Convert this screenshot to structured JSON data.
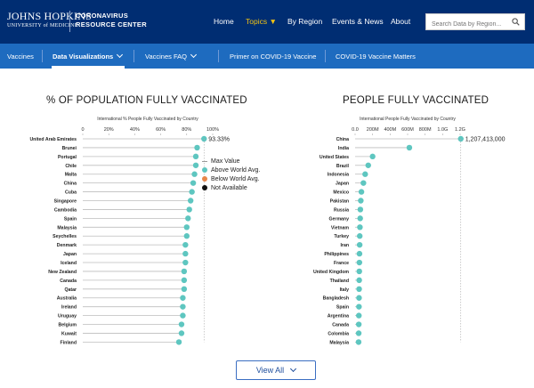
{
  "header": {
    "logo_line1": "JOHNS HOPKINS",
    "logo_line2": "UNIVERSITY of MEDICINE",
    "logo_crc_1": "CORONAVIRUS",
    "logo_crc_2": "RESOURCE CENTER",
    "nav": [
      {
        "label": "Home"
      },
      {
        "label": "Topics ▼"
      },
      {
        "label": "By Region"
      },
      {
        "label": "Events & News"
      },
      {
        "label": "About"
      }
    ],
    "search_placeholder": "Search Data by Region..."
  },
  "subnav": [
    {
      "label": "Vaccines"
    },
    {
      "label": "Data Visualizations"
    },
    {
      "label": "Vaccines FAQ"
    },
    {
      "label": "Primer on COVID-19 Vaccine"
    },
    {
      "label": "COVID-19 Vaccine Matters"
    }
  ],
  "colors": {
    "navy": "#002D72",
    "blue": "#1e6bbf",
    "accent": "#f2c413",
    "dot": "#5ec6c0"
  },
  "legend": {
    "max": "Max Value",
    "above": "Above World Avg.",
    "below": "Below World Avg.",
    "na": "Not Available",
    "above_color": "#5ec6c0",
    "below_color": "#e8864a",
    "na_color": "#111111"
  },
  "view_all": "View All",
  "chart_data": [
    {
      "type": "scatter",
      "title": "% OF POPULATION FULLY VACCINATED",
      "subtitle": "International % People Fully Vaccinated by Country",
      "xlim": [
        0,
        100
      ],
      "ticks": [
        "0",
        "20%",
        "40%",
        "60%",
        "80%",
        "100%"
      ],
      "max_label": "93.33%",
      "categories": [
        "United Arab Emirates",
        "Brunei",
        "Portugal",
        "Chile",
        "Malta",
        "China",
        "Cuba",
        "Singapore",
        "Cambodia",
        "Spain",
        "Malaysia",
        "Seychelles",
        "Denmark",
        "Japan",
        "Iceland",
        "New Zealand",
        "Canada",
        "Qatar",
        "Australia",
        "Ireland",
        "Uruguay",
        "Belgium",
        "Kuwait",
        "Finland"
      ],
      "values": [
        93.33,
        88,
        87,
        87,
        86,
        85,
        84,
        83,
        82,
        81,
        80,
        80,
        79,
        79,
        79,
        78,
        78,
        78,
        77,
        77,
        77,
        76,
        76,
        74
      ]
    },
    {
      "type": "scatter",
      "title": "PEOPLE FULLY VACCINATED",
      "subtitle": "International People Fully Vaccinated by Country",
      "xlim": [
        0,
        1200000000
      ],
      "ticks": [
        "0.0",
        "200M",
        "400M",
        "600M",
        "800M",
        "1.0G",
        "1.2G"
      ],
      "max_label": "1,207,413,000",
      "categories": [
        "China",
        "India",
        "United States",
        "Brazil",
        "Indonesia",
        "Japan",
        "Mexico",
        "Pakistan",
        "Russia",
        "Germany",
        "Vietnam",
        "Turkey",
        "Iran",
        "Philippines",
        "France",
        "United Kingdom",
        "Thailand",
        "Italy",
        "Bangladesh",
        "Spain",
        "Argentina",
        "Canada",
        "Colombia",
        "Malaysia"
      ],
      "values": [
        1207413000,
        620000000,
        200000000,
        150000000,
        115000000,
        95000000,
        72000000,
        65000000,
        60000000,
        58000000,
        55000000,
        53000000,
        52000000,
        50000000,
        49000000,
        48000000,
        47000000,
        46000000,
        45000000,
        44000000,
        43000000,
        42000000,
        41000000,
        40000000
      ]
    }
  ]
}
